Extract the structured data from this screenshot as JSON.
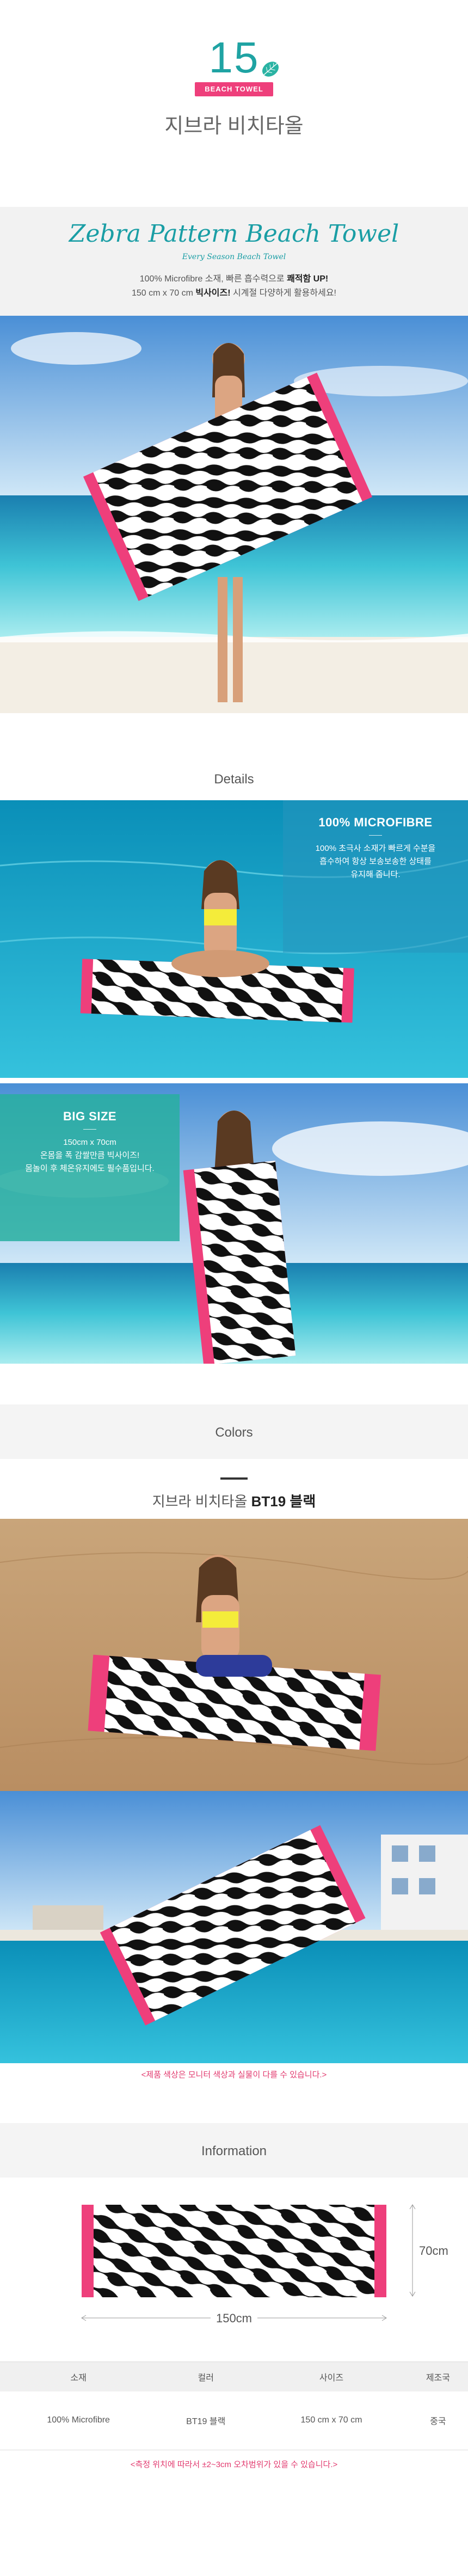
{
  "header": {
    "number": "15",
    "ribbon": "BEACH TOWEL",
    "title": "지브라 비치타올"
  },
  "intro": {
    "script_title": "Zebra Pattern Beach Towel",
    "script_subtitle": "Every Season Beach Towel",
    "line1_a": "100% Microfibre 소재, 빠른 흡수력으로 ",
    "line1_b": "쾌적함 UP!",
    "line2_a": "150 cm x 70 cm ",
    "line2_b": "빅사이즈!",
    "line2_c": " 시계절 다양하게 활용하세요!"
  },
  "details": {
    "heading": "Details",
    "microfibre_title": "100% MICROFIBRE",
    "microfibre_lines": [
      "100% 초극사 소재가 빠르게 수분을",
      "흡수하여 항상 보송보송한 상태를",
      "유지해 줍니다."
    ],
    "bigsize_title": "BIG SIZE",
    "bigsize_lines": [
      "150cm x 70cm",
      "온몸을 폭 감쌀만큼 빅사이즈!",
      "몸놀이 후 체온유지에도 필수품입니다."
    ]
  },
  "colors": {
    "heading": "Colors",
    "product_name": "지브라 비치타올 ",
    "product_code": "BT19 블랙",
    "notice": "<제품 색상은 모니터 색상과 실물이 다를 수 있습니다.>"
  },
  "information": {
    "heading": "Information",
    "height_label": "70cm",
    "width_label": "150cm",
    "table_headers": [
      "소재",
      "컬러",
      "사이즈",
      "제조국"
    ],
    "table_values": [
      "100% Microfibre",
      "BT19 블랙",
      "150 cm x 70 cm",
      "중국"
    ],
    "notice": "<측정 위치에 따라서 ±2~3cm 오차범위가 있을 수 있습니다.>"
  },
  "colors_palette": {
    "teal": "#1fa3a3",
    "pink": "#ee3f7b",
    "notice_red": "#e23a6f"
  }
}
